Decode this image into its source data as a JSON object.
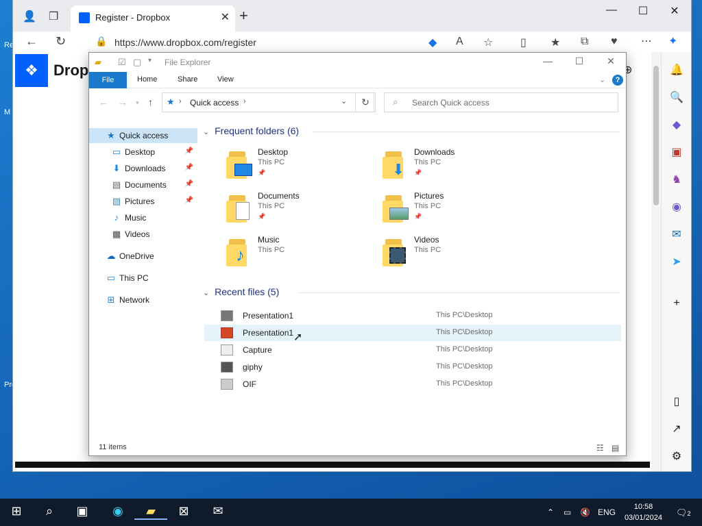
{
  "desktop": {
    "left_labels": [
      "Re",
      "M",
      "Pre"
    ]
  },
  "browser": {
    "tab_title": "Register - Dropbox",
    "tab_close": "✕",
    "new_tab": "+",
    "url": "https://www.dropbox.com/register",
    "page_logo_text": "Drop",
    "window_controls": {
      "minimize": "—",
      "maximize": "☐",
      "close": "✕"
    }
  },
  "explorer": {
    "title": "File Explorer",
    "ribbon_tabs": [
      "File",
      "Home",
      "Share",
      "View"
    ],
    "help": "?",
    "address": "Quick access",
    "search_placeholder": "Search Quick access",
    "nav": [
      {
        "label": "Quick access",
        "icon": "star-icon",
        "pinned": false,
        "selected": true
      },
      {
        "label": "Desktop",
        "icon": "desktop-icon",
        "pinned": true
      },
      {
        "label": "Downloads",
        "icon": "download-arrow-icon",
        "pinned": true
      },
      {
        "label": "Documents",
        "icon": "document-icon",
        "pinned": true
      },
      {
        "label": "Pictures",
        "icon": "picture-icon",
        "pinned": true
      },
      {
        "label": "Music",
        "icon": "music-note-icon",
        "pinned": false
      },
      {
        "label": "Videos",
        "icon": "video-icon",
        "pinned": false
      },
      {
        "label": "OneDrive",
        "icon": "cloud-icon",
        "pinned": false
      },
      {
        "label": "This PC",
        "icon": "monitor-icon",
        "pinned": false
      },
      {
        "label": "Network",
        "icon": "network-icon",
        "pinned": false
      }
    ],
    "frequent_header": "Frequent folders (6)",
    "frequent": [
      {
        "name": "Desktop",
        "location": "This PC",
        "pinned": true,
        "overlay": "desktop"
      },
      {
        "name": "Downloads",
        "location": "This PC",
        "pinned": true,
        "overlay": "downloads"
      },
      {
        "name": "Documents",
        "location": "This PC",
        "pinned": true,
        "overlay": "documents"
      },
      {
        "name": "Pictures",
        "location": "This PC",
        "pinned": true,
        "overlay": "pictures"
      },
      {
        "name": "Music",
        "location": "This PC",
        "pinned": false,
        "overlay": "music"
      },
      {
        "name": "Videos",
        "location": "This PC",
        "pinned": false,
        "overlay": "videos"
      }
    ],
    "recent_header": "Recent files (5)",
    "recent": [
      {
        "name": "Presentation1",
        "path": "This PC\\Desktop",
        "thumb_color": "#777777"
      },
      {
        "name": "Presentation1",
        "path": "This PC\\Desktop",
        "thumb_color": "#d24726"
      },
      {
        "name": "Capture",
        "path": "This PC\\Desktop",
        "thumb_color": "#eeeeee"
      },
      {
        "name": "giphy",
        "path": "This PC\\Desktop",
        "thumb_color": "#555555"
      },
      {
        "name": "OIF",
        "path": "This PC\\Desktop",
        "thumb_color": "#cccccc"
      }
    ],
    "status": "11 items",
    "accent": "#1979ca"
  },
  "taskbar": {
    "language": "ENG",
    "time": "10:58",
    "date": "03/01/2024",
    "notifications": "2"
  }
}
